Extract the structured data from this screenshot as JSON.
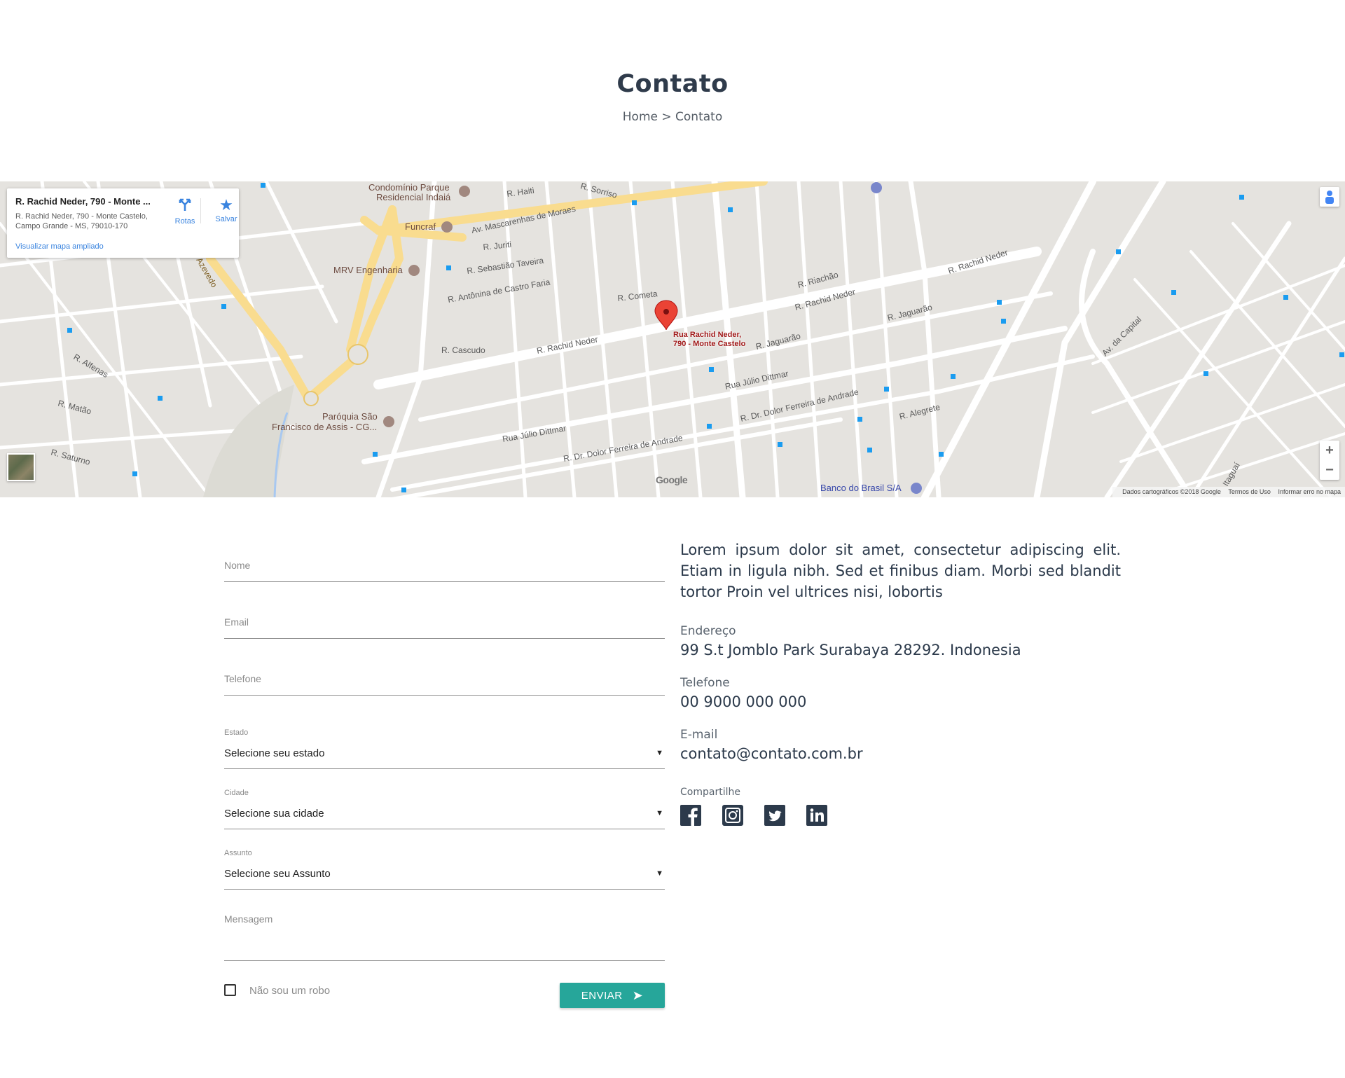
{
  "header": {
    "title": "Contato",
    "breadcrumb": "Home > Contato"
  },
  "map": {
    "card_title": "R. Rachid Neder, 790 - Monte ...",
    "card_address_line1": "R. Rachid Neder, 790 - Monte Castelo,",
    "card_address_line2": "Campo Grande - MS, 79010-170",
    "directions_label": "Rotas",
    "save_label": "Salvar",
    "enlarge_label": "Visualizar mapa ampliado",
    "pin_label_line1": "Rua Rachid Neder,",
    "pin_label_line2": "790 - Monte Castelo",
    "attribution": "Dados cartográficos ©2018 Google",
    "terms": "Termos de Uso",
    "report": "Informar erro no mapa",
    "google_logo": "Google",
    "zoom_in": "+",
    "zoom_out": "−",
    "labels": {
      "condominio": "Condomínio Parque",
      "condominio2": "Residencial Indaiá",
      "funcraf": "Funcraf",
      "mrv": "MRV Engenharia",
      "paroquia": "Paróquia São",
      "paroquia2": "Francisco de Assis - CG...",
      "banco": "Banco do Brasil S/A",
      "mascarenhas": "Av. Mascarenhas de Moraes",
      "rachid1": "R. Rachid Neder",
      "rachid2": "R. Rachid Neder",
      "rachid3": "R. Rachid Neder",
      "jaguarao1": "R. Jaguarão",
      "jaguarao2": "R. Jaguarão",
      "juliodittmar1": "Rua Júlio Dittmar",
      "juliodittmar2": "Rua Júlio Dittmar",
      "dolor1": "R. Dr. Dolor Ferreira de Andrade",
      "dolor2": "R. Dr. Dolor Ferreira de Andrade",
      "alegrete": "R. Alegrete",
      "cometa": "R. Cometa",
      "riachao": "R. Riachão",
      "cascudo": "R. Cascudo",
      "juriti": "R. Juriti",
      "sebastiao": "R. Sebastião Taveira",
      "antonina": "R. Antônina de Castro Faria",
      "haiti": "R. Haiti",
      "sorriso": "R. Sorriso",
      "matao": "R. Matão",
      "saturno": "R. Saturno",
      "alfenas": "R. Alfenas",
      "azevedo": "de Azevedo",
      "capital": "Av. da Capital",
      "itaquera": "Itaguaí"
    }
  },
  "form": {
    "name_placeholder": "Nome",
    "email_placeholder": "Email",
    "phone_placeholder": "Telefone",
    "state_label": "Estado",
    "state_value": "Selecione seu estado",
    "city_label": "Cidade",
    "city_value": "Selecione sua cidade",
    "subject_label": "Assunto",
    "subject_value": "Selecione seu Assunto",
    "message_placeholder": "Mensagem",
    "captcha_label": "Não sou um robo",
    "submit_label": "ENVIAR",
    "caret": "▼"
  },
  "contact": {
    "lead": "Lorem ipsum dolor sit amet, consectetur adipiscing elit. Etiam in ligula nibh. Sed et finibus diam. Morbi sed blandit tortor Proin vel ultrices nisi, lobortis",
    "address_label": "Endereço",
    "address_value": "99 S.t Jomblo Park Surabaya 28292. Indonesia",
    "phone_label": "Telefone",
    "phone_value": "00 9000 000 000",
    "email_label": "E-mail",
    "email_value": "contato@contato.com.br",
    "share_label": "Compartilhe",
    "social": [
      "facebook-icon",
      "instagram-icon",
      "twitter-icon",
      "linkedin-icon"
    ]
  },
  "colors": {
    "accent": "#26a69a",
    "text": "#2c3a4b",
    "map_bg": "#e5e3df",
    "highway": "#f9dc8f",
    "pin": "#ea4335"
  }
}
